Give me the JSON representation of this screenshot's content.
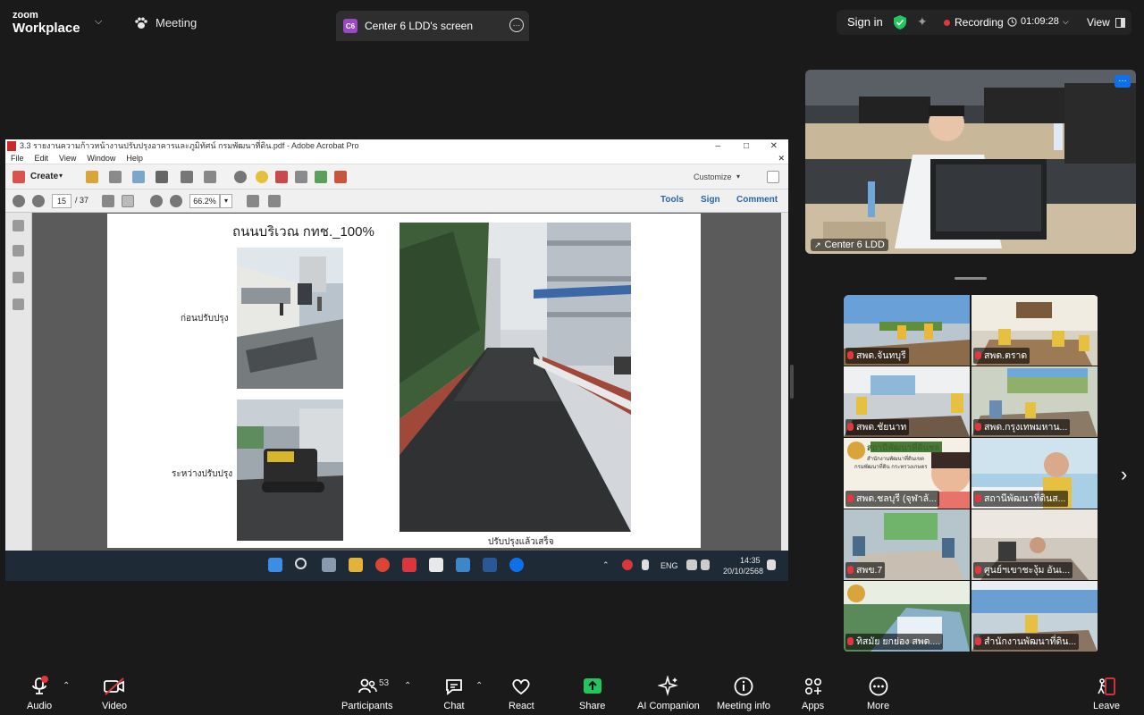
{
  "topbar": {
    "logo_line1": "zoom",
    "logo_line2": "Workplace",
    "meeting_label": "Meeting",
    "screen_badge": "C6",
    "screen_tab_label": "Center 6 LDD's screen",
    "signin_label": "Sign in",
    "recording_label": "Recording",
    "timer": "01:09:28",
    "view_label": "View"
  },
  "acrobat": {
    "title": "3.3 รายงานความก้าวหน้างานปรับปรุงอาคารและภูมิทัศน์ กรมพัฒนาที่ดิน.pdf - Adobe Acrobat Pro",
    "menu": [
      "File",
      "Edit",
      "View",
      "Window",
      "Help"
    ],
    "create_label": "Create",
    "customize_label": "Customize",
    "page_current": "15",
    "page_total": "/ 37",
    "zoom": "66.2%",
    "tools_label": "Tools",
    "sign_label": "Sign",
    "comment_label": "Comment"
  },
  "document": {
    "title": "ถนนบริเวณ กทช._100%",
    "label_before": "ก่อนปรับปรุง",
    "label_during": "ระหว่างปรับปรุง",
    "caption_after": "ปรับปรุงแล้วเสร็จ"
  },
  "taskbar": {
    "lang": "ENG",
    "time": "14:35",
    "date": "20/10/2568"
  },
  "speaker": {
    "name": "Center 6 LDD"
  },
  "gallery": {
    "tiles": [
      {
        "name": "สพด.จันทบุรี"
      },
      {
        "name": "สพด.ตราด"
      },
      {
        "name": "สพด.ชัยนาท"
      },
      {
        "name": "สพด.กรุงเทพมหาน..."
      },
      {
        "name": "สพด.ชลบุรี (จุฬาลั..."
      },
      {
        "name": "สถานีพัฒนาที่ดินส..."
      },
      {
        "name": "สพข.7"
      },
      {
        "name": "ศูนย์ฯเขาชะงุ้ม อันเ..."
      },
      {
        "name": "ทิสมัย ยกย่อง สพด...."
      },
      {
        "name": "สำนักงานพัฒนาที่ดิน..."
      }
    ],
    "sign_text": "สถานีพัฒนาที่ดินชล",
    "sign_sub1": "สำนักงานพัฒนาที่ดินเขต",
    "sign_sub2": "กรมพัฒนาที่ดิน กระทรวงเกษตร"
  },
  "controls": {
    "audio": "Audio",
    "video": "Video",
    "participants": "Participants",
    "participants_count": "53",
    "chat": "Chat",
    "react": "React",
    "share": "Share",
    "ai": "AI Companion",
    "info": "Meeting info",
    "apps": "Apps",
    "more": "More",
    "leave": "Leave"
  },
  "colors": {
    "share_green": "#22c55e",
    "recording_red": "#e0383e",
    "zoom_blue": "#0e71eb",
    "shield_green": "#22c55e"
  }
}
